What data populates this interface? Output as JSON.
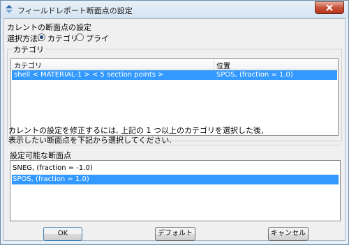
{
  "window": {
    "title": "フィールドレポート断面点の設定",
    "close_icon": "close-icon"
  },
  "section": {
    "heading": "カレントの断面点の設定",
    "selection_method_label": "選択方法:",
    "options": [
      {
        "label": "カテゴリ",
        "selected": true
      },
      {
        "label": "プライ",
        "selected": false
      }
    ]
  },
  "category_group": {
    "label": "カテゴリ",
    "columns": [
      "カテゴリ",
      "位置"
    ],
    "rows": [
      {
        "category": "shell < MATERIAL-1 > < 5 section points >",
        "position": "SPOS, (fraction = 1.0)",
        "selected": true
      }
    ]
  },
  "instruction": {
    "line1": "カレントの設定を修正するには, 上記の 1 つ以上のカテゴリを選択した後,",
    "line2": "表示したい断面点を下記から選択してください."
  },
  "available_points": {
    "label": "設定可能な断面点",
    "items": [
      {
        "label": "SNEG, (fraction = -1.0)",
        "selected": false
      },
      {
        "label": "SPOS, (fraction = 1.0)",
        "selected": true
      }
    ]
  },
  "buttons": {
    "ok": "OK",
    "default": "デフォルト",
    "cancel": "キャンセル"
  }
}
